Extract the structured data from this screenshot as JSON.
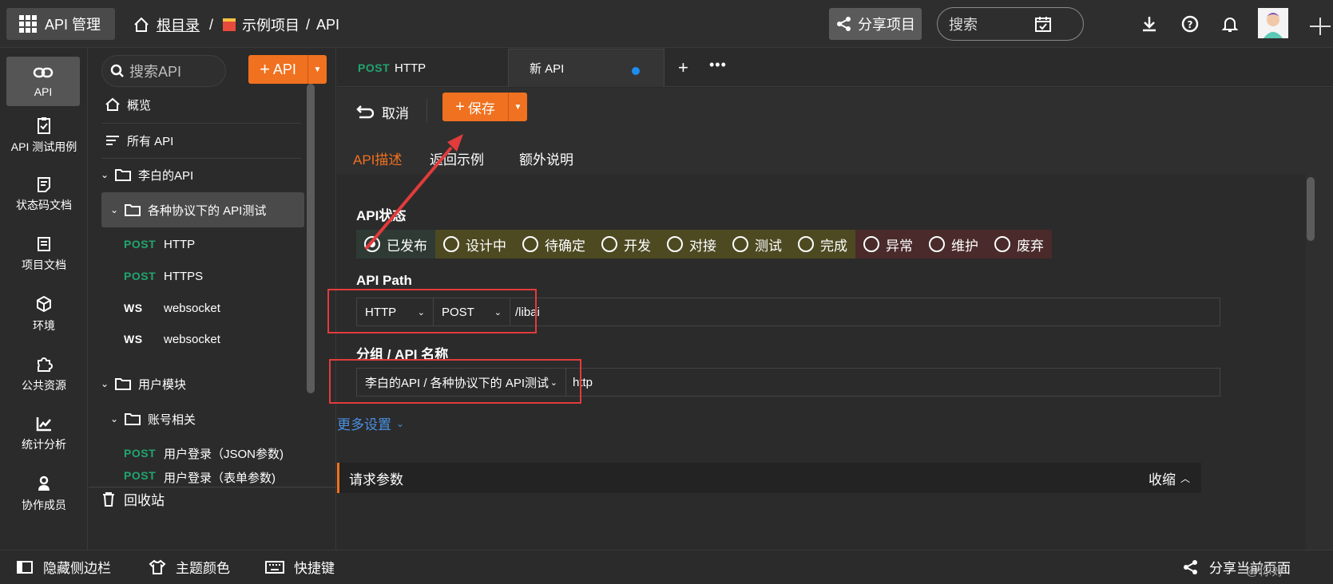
{
  "topbar": {
    "app_title": "API 管理",
    "breadcrumb_root": "根目录",
    "breadcrumb_sep": "/",
    "breadcrumb_project": "示例项目",
    "breadcrumb_sep2": "/",
    "breadcrumb_current": "API",
    "share_label": "分享项目",
    "search_placeholder": "搜索"
  },
  "leftnav": {
    "items": [
      {
        "label": "API",
        "icon": "link-icon"
      },
      {
        "label": "API 测试用例",
        "icon": "clipboard-check-icon"
      },
      {
        "label": "状态码文档",
        "icon": "doc-icon"
      },
      {
        "label": "项目文档",
        "icon": "book-icon"
      },
      {
        "label": "环境",
        "icon": "codesandbox-icon"
      },
      {
        "label": "公共资源",
        "icon": "puzzle-icon"
      },
      {
        "label": "统计分析",
        "icon": "chart-icon"
      },
      {
        "label": "协作成员",
        "icon": "users-icon"
      }
    ]
  },
  "sidebar": {
    "search_placeholder": "搜索API",
    "add_label": "API",
    "overview": "概览",
    "all_api": "所有 API",
    "folder1": "李白的API",
    "folder1_sub": "各种协议下的 API测试",
    "apis": [
      {
        "method": "POST",
        "name": "HTTP"
      },
      {
        "method": "POST",
        "name": "HTTPS"
      },
      {
        "method": "WS",
        "name": "websocket"
      },
      {
        "method": "WS",
        "name": "websocket"
      }
    ],
    "folder2": "用户模块",
    "folder2_sub": "账号相关",
    "apis2": [
      {
        "method": "POST",
        "name": "用户登录（JSON参数)"
      },
      {
        "method": "POST",
        "name": "用户登录（表单参数)"
      }
    ],
    "recycle": "回收站"
  },
  "tabs": {
    "tab1_method": "POST",
    "tab1_name": "HTTP",
    "tab2_name": "新 API"
  },
  "toolbar": {
    "cancel_label": "取消",
    "save_label": "保存"
  },
  "subtabs": [
    "API描述",
    "返回示例",
    "额外说明"
  ],
  "form": {
    "status_label": "API状态",
    "statuses": [
      {
        "label": "已发布",
        "color": "#2f3a35",
        "selected": true
      },
      {
        "label": "设计中",
        "color": "#4d4a22"
      },
      {
        "label": "待确定",
        "color": "#4d4a22"
      },
      {
        "label": "开发",
        "color": "#4d4a22"
      },
      {
        "label": "对接",
        "color": "#4d4a22"
      },
      {
        "label": "测试",
        "color": "#4d4a22"
      },
      {
        "label": "完成",
        "color": "#4d4a22"
      },
      {
        "label": "异常",
        "color": "#4a2a2a"
      },
      {
        "label": "维护",
        "color": "#4a2a2a"
      },
      {
        "label": "废弃",
        "color": "#4a2a2a"
      }
    ],
    "path_label": "API Path",
    "protocol": "HTTP",
    "method": "POST",
    "path": "/libai",
    "group_label": "分组 / API 名称",
    "group": "李白的API / 各种协议下的 API测试",
    "api_name": "http",
    "more_settings": "更多设置",
    "req_params": "请求参数",
    "collapse": "收缩"
  },
  "bottombar": {
    "hide_sidebar": "隐藏侧边栏",
    "theme": "主题颜色",
    "shortcuts": "快捷键",
    "share_page": "分享当前页面",
    "watermark": "@你好"
  },
  "colors": {
    "accent": "#f0711f",
    "post_green": "#21a56f",
    "link_blue": "#4a90e2",
    "annotation_red": "#e23b3b"
  }
}
